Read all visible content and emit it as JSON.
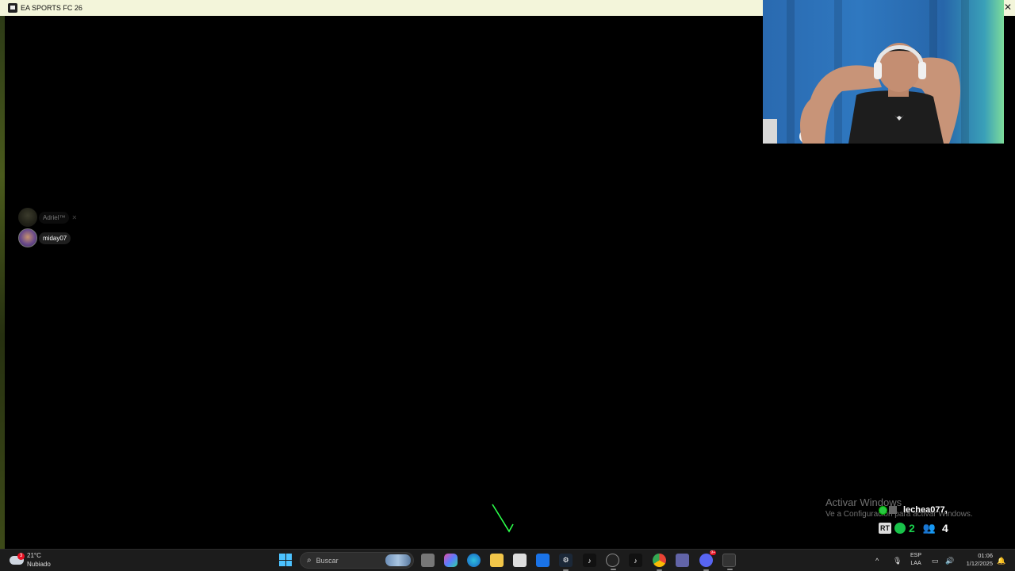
{
  "window": {
    "title": "EA SPORTS FC 26",
    "close_glyph": "✕"
  },
  "voice_users": [
    {
      "name": "Adriel™",
      "speaking": false
    },
    {
      "name": "miday07",
      "speaking": true
    }
  ],
  "activation": {
    "line1": "Activar Windows",
    "line2": "Ve a Configuración para activar Windows."
  },
  "overlay": {
    "username": "lechea077,",
    "rt_label": "RT",
    "green_count": "2",
    "people_count": "4"
  },
  "taskbar": {
    "weather_temp": "21°C",
    "weather_desc": "Nubiado",
    "weather_badge": "3",
    "search_placeholder": "Buscar",
    "language_line1": "ESP",
    "language_line2": "LAA",
    "time": "01:06",
    "date": "1/12/2025",
    "tray_chevron": "^",
    "notification_badge_discord": "9+"
  },
  "colors": {
    "titlebar": "#f3f5da",
    "accent_green": "#19d24d",
    "windows_blue": "#4cc2ff"
  }
}
